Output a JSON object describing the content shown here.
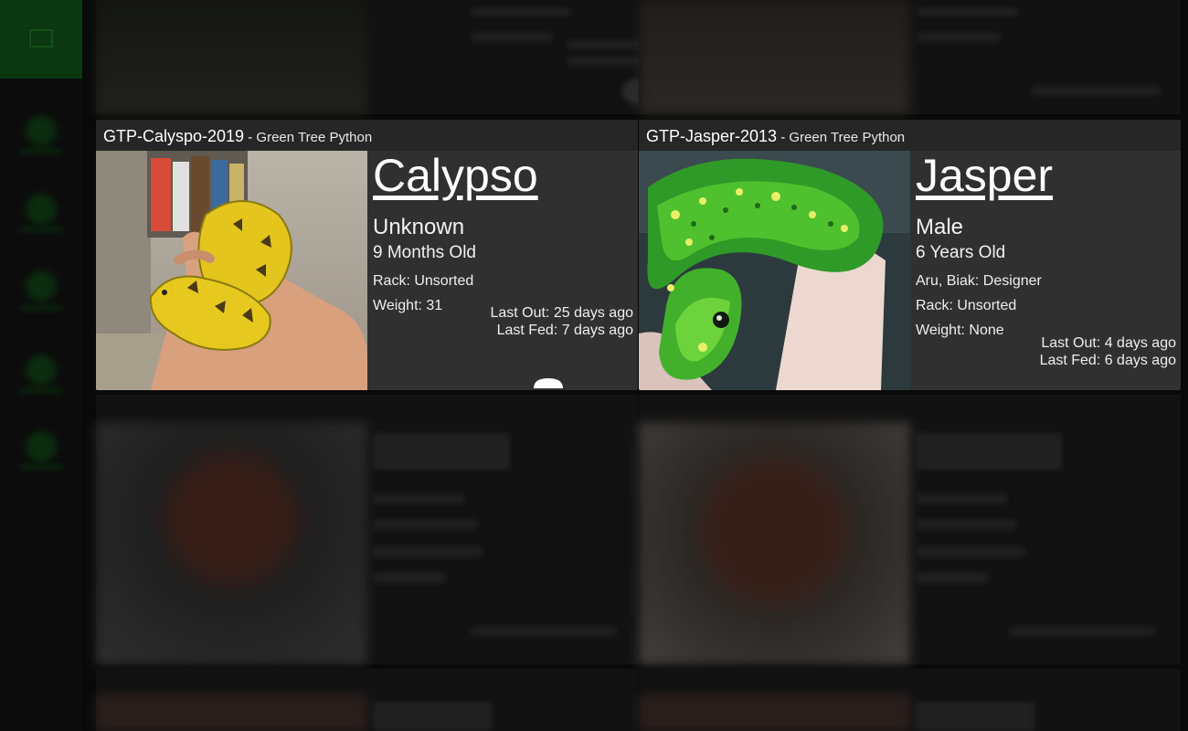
{
  "cards": [
    {
      "header_id": "GTP-Calyspo-2019",
      "header_sep": " - ",
      "species": "Green Tree Python",
      "name": "Calypso",
      "sex": "Unknown",
      "age": "9 Months Old",
      "rack": "Rack: Unsorted",
      "weight": "Weight: 31",
      "last_out": "Last Out: 25 days ago",
      "last_fed": "Last Fed: 7 days ago",
      "feed_icon": "hamburger-icon"
    },
    {
      "header_id": "GTP-Jasper-2013",
      "header_sep": " - ",
      "species": "Green Tree Python",
      "name": "Jasper",
      "sex": "Male",
      "age": "6 Years Old",
      "genetics": "Aru, Biak: Designer",
      "rack": "Rack: Unsorted",
      "weight": "Weight: None",
      "last_out": "Last Out: 4 days ago",
      "last_fed": "Last Fed: 6 days ago"
    }
  ],
  "colors": {
    "card_bg": "#303030",
    "header_bg": "#262626",
    "sidebar_accent": "#0f4a17"
  }
}
